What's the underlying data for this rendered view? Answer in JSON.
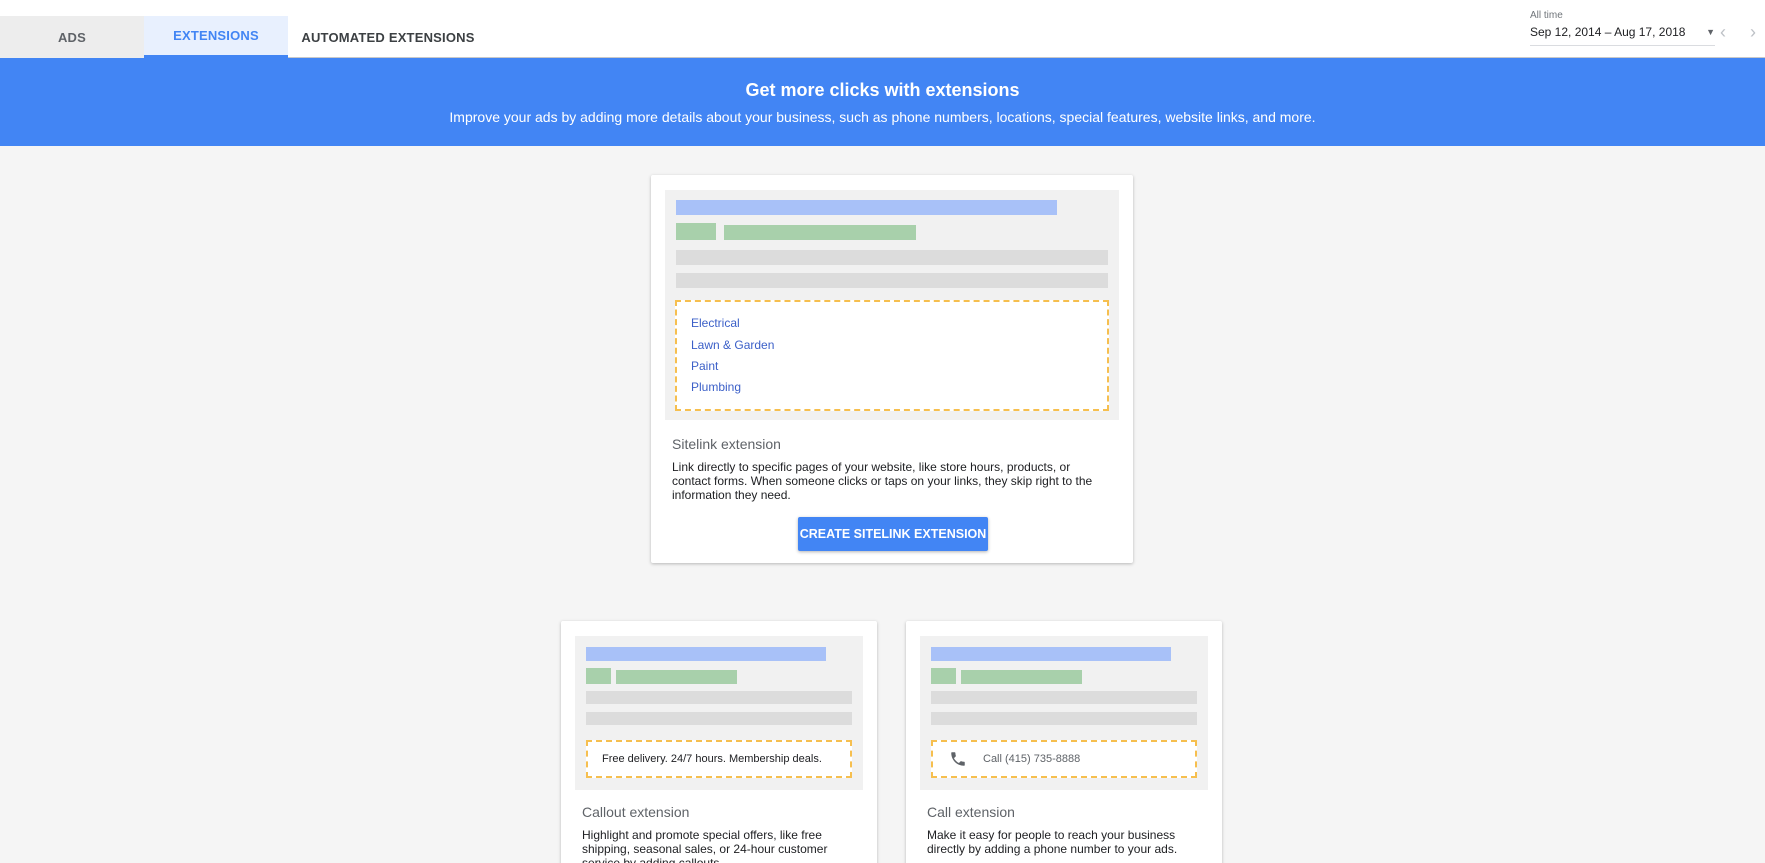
{
  "tabs": {
    "ads": "ADS",
    "extensions": "EXTENSIONS",
    "automated": "AUTOMATED EXTENSIONS"
  },
  "date_range": {
    "label": "All time",
    "value": "Sep 12, 2014 – Aug 17, 2018"
  },
  "banner": {
    "title": "Get more clicks with extensions",
    "subtitle": "Improve your ads by adding more details about your business, such as phone numbers, locations, special features, website links, and more."
  },
  "sitelink_card": {
    "links": [
      "Electrical",
      "Lawn & Garden",
      "Paint",
      "Plumbing"
    ],
    "title": "Sitelink extension",
    "description": "Link directly to specific pages of your website, like store hours, products, or contact forms. When someone clicks or taps on your links, they skip right to the information they need.",
    "button": "CREATE SITELINK EXTENSION"
  },
  "callout_card": {
    "preview_text": "Free delivery. 24/7 hours. Membership deals.",
    "title": "Callout extension",
    "description": "Highlight and promote special offers, like free shipping, seasonal sales, or 24-hour customer service by adding callouts."
  },
  "call_card": {
    "preview_text": "Call (415) 735-8888",
    "title": "Call extension",
    "description": "Make it easy for people to reach your business directly by adding a phone number to your ads."
  },
  "colors": {
    "accent": "#4285f4",
    "preview_title": "#a8c1f8",
    "preview_url": "#a8d0ab",
    "preview_line": "#dcdcdc",
    "highlight_border": "#f6bf4f",
    "link": "#3c60c8"
  },
  "icons": {
    "prev": "chevron-left-icon",
    "next": "chevron-right-icon",
    "dropdown": "caret-down-icon",
    "phone": "phone-icon"
  }
}
